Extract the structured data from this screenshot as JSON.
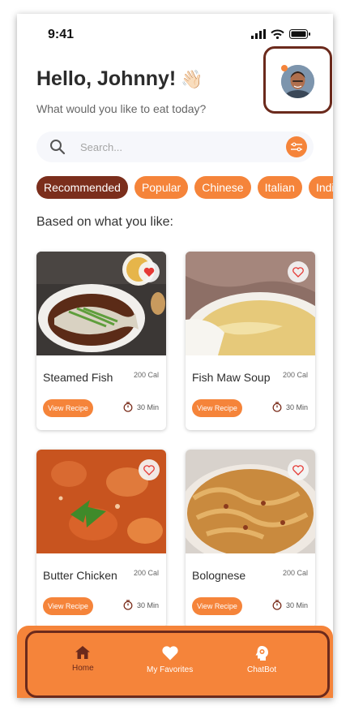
{
  "status_bar": {
    "time": "9:41"
  },
  "header": {
    "greeting": "Hello, Johnny!",
    "greeting_emoji": "👋🏻",
    "subtitle": "What would you like to eat today?"
  },
  "search": {
    "placeholder": "Search..."
  },
  "categories": [
    {
      "label": "Recommended",
      "active": true
    },
    {
      "label": "Popular",
      "active": false
    },
    {
      "label": "Chinese",
      "active": false
    },
    {
      "label": "Italian",
      "active": false
    },
    {
      "label": "Indian",
      "active": false
    }
  ],
  "section_title": "Based on what you like:",
  "recipes": [
    {
      "name": "Steamed Fish",
      "calories": "200 Cal",
      "button": "View Recipe",
      "time": "30 Min",
      "favorite": true
    },
    {
      "name": "Fish Maw Soup",
      "calories": "200 Cal",
      "button": "View Recipe",
      "time": "30 Min",
      "favorite": false
    },
    {
      "name": "Butter Chicken",
      "calories": "200 Cal",
      "button": "View Recipe",
      "time": "30 Min",
      "favorite": false
    },
    {
      "name": "Bolognese",
      "calories": "200 Cal",
      "button": "View Recipe",
      "time": "30 Min",
      "favorite": false
    }
  ],
  "nav": [
    {
      "label": "Home",
      "icon": "home-icon",
      "active": true
    },
    {
      "label": "My Favorites",
      "icon": "heart-icon",
      "active": false
    },
    {
      "label": "ChatBot",
      "icon": "chatbot-icon",
      "active": false
    }
  ],
  "colors": {
    "accent": "#f5843a",
    "accent_dark": "#7b2e1c",
    "outline": "#6b2a1c"
  }
}
